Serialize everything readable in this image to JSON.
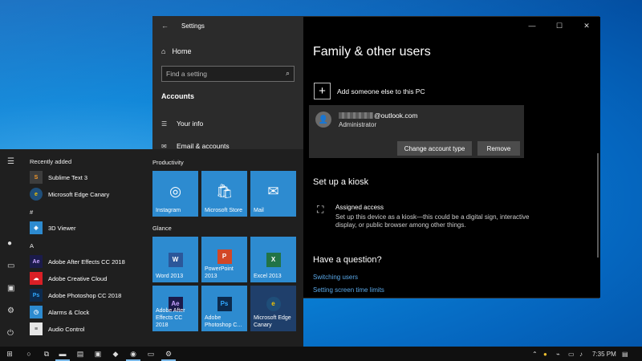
{
  "settings_window": {
    "title": "Settings",
    "back_glyph": "←",
    "controls": {
      "minimize": "—",
      "maximize": "☐",
      "close": "✕"
    },
    "nav": {
      "home_label": "Home",
      "search_placeholder": "Find a setting",
      "section_label": "Accounts",
      "items": [
        {
          "label": "Your info",
          "icon": "person-card-icon"
        },
        {
          "label": "Email & accounts",
          "icon": "mail-icon"
        }
      ]
    },
    "content": {
      "title": "Family & other users",
      "add_label": "Add someone else to this PC",
      "account": {
        "email_suffix": "@outlook.com",
        "role": "Administrator",
        "change_button": "Change account type",
        "remove_button": "Remove"
      },
      "kiosk": {
        "heading": "Set up a kiosk",
        "title": "Assigned access",
        "description": "Set up this device as a kiosk—this could be a digital sign, interactive display, or public browser among other things."
      },
      "question": {
        "heading": "Have a question?",
        "links": [
          "Switching users",
          "Setting screen time limits"
        ]
      }
    }
  },
  "start_menu": {
    "recently_added_label": "Recently added",
    "recent_apps": [
      {
        "label": "Sublime Text 3",
        "icon": "sublime-text-icon",
        "color": "#3d3d3d"
      },
      {
        "label": "Microsoft Edge Canary",
        "icon": "edge-canary-icon",
        "color": "#1f4e79"
      }
    ],
    "hash_header": "#",
    "hash_apps": [
      {
        "label": "3D Viewer",
        "icon": "3d-viewer-icon",
        "color": "#2d8bd0"
      }
    ],
    "a_header": "A",
    "a_apps": [
      {
        "label": "Adobe After Effects CC 2018",
        "icon": "after-effects-icon",
        "badge": "Ae",
        "color": "#1b1b4b"
      },
      {
        "label": "Adobe Creative Cloud",
        "icon": "creative-cloud-icon",
        "color": "#da1f26"
      },
      {
        "label": "Adobe Photoshop CC 2018",
        "icon": "photoshop-icon",
        "badge": "Ps",
        "color": "#0c2a4d"
      },
      {
        "label": "Alarms & Clock",
        "icon": "alarms-clock-icon",
        "color": "#2d8bd0"
      },
      {
        "label": "Audio Control",
        "icon": "audio-control-icon",
        "color": "#e6e6e6"
      }
    ],
    "groups": {
      "productivity": "Productivity",
      "glance": "Glance"
    },
    "tiles_productivity": [
      {
        "label": "Instagram",
        "icon": "instagram-icon",
        "glyph": "◎"
      },
      {
        "label": "Microsoft Store",
        "icon": "store-icon",
        "glyph": "🛍"
      },
      {
        "label": "Mail",
        "icon": "mail-icon",
        "glyph": "✉"
      }
    ],
    "tiles_glance": [
      {
        "label": "Word 2013",
        "icon": "word-icon",
        "badge": "W",
        "badge_color": "#2b579a"
      },
      {
        "label": "PowerPoint 2013",
        "icon": "powerpoint-icon",
        "badge": "P",
        "badge_color": "#d24726"
      },
      {
        "label": "Excel 2013",
        "icon": "excel-icon",
        "badge": "X",
        "badge_color": "#217346"
      },
      {
        "label": "Adobe After Effects CC 2018",
        "icon": "after-effects-icon",
        "badge": "Ae",
        "badge_color": "#1b1b4b"
      },
      {
        "label": "Adobe Photoshop C...",
        "icon": "photoshop-icon",
        "badge": "Ps",
        "badge_color": "#0c2a4d"
      },
      {
        "label": "Microsoft Edge Canary",
        "icon": "edge-canary-icon",
        "badge": "e",
        "badge_color": "#1f4e79"
      }
    ]
  },
  "taskbar": {
    "clock": "7:35 PM"
  },
  "colors": {
    "tile_blue": "#2d8bd0",
    "link_blue": "#5aa8e8",
    "settings_nav_bg": "#2b2b2b"
  }
}
